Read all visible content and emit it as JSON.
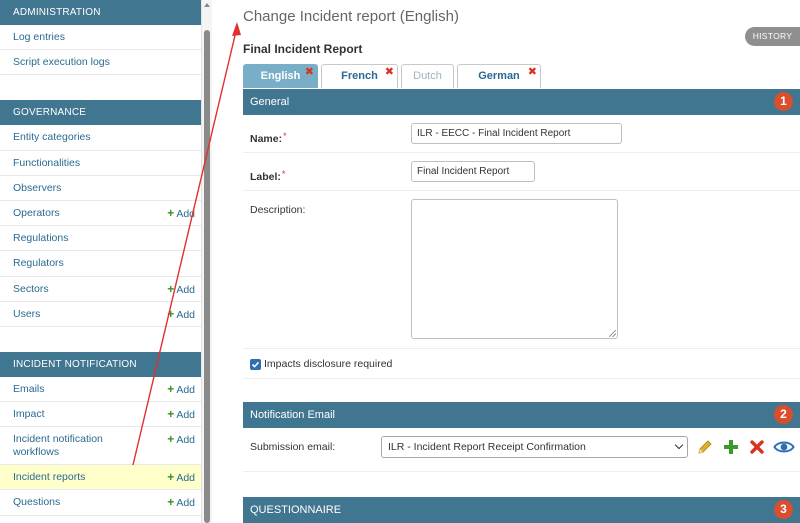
{
  "sidebar": {
    "administration": {
      "header": "ADMINISTRATION",
      "items": [
        {
          "label": "Log entries"
        },
        {
          "label": "Script execution logs"
        }
      ]
    },
    "governance": {
      "header": "GOVERNANCE",
      "items": [
        {
          "label": "Entity categories",
          "add": ""
        },
        {
          "label": "Functionalities",
          "add": ""
        },
        {
          "label": "Observers",
          "add": ""
        },
        {
          "label": "Operators",
          "add": "Add"
        },
        {
          "label": "Regulations",
          "add": ""
        },
        {
          "label": "Regulators",
          "add": ""
        },
        {
          "label": "Sectors",
          "add": "Add"
        },
        {
          "label": "Users",
          "add": "Add"
        }
      ]
    },
    "incident_notification": {
      "header": "INCIDENT NOTIFICATION",
      "items": [
        {
          "label": "Emails",
          "add": "Add"
        },
        {
          "label": "Impact",
          "add": "Add"
        },
        {
          "label_line1": "Incident notification",
          "label_line2": "workflows",
          "add": "Add"
        },
        {
          "label": "Incident reports",
          "add": "Add"
        },
        {
          "label": "Questions",
          "add": "Add"
        }
      ]
    }
  },
  "main": {
    "page_title": "Change Incident report (English)",
    "object_title": "Final Incident Report",
    "history_label": "HISTORY",
    "tabs": [
      {
        "label": "English",
        "state": "active"
      },
      {
        "label": "French",
        "state": "normal"
      },
      {
        "label": "Dutch",
        "state": "disabled"
      },
      {
        "label": "German",
        "state": "normal"
      }
    ],
    "general": {
      "header": "General",
      "badge": "1",
      "name_label": "Name:",
      "name_value": "ILR - EECC - Final Incident Report",
      "label_label": "Label:",
      "label_value": "Final Incident Report",
      "description_label": "Description:",
      "description_value": "",
      "checkbox_label": "Impacts disclosure required",
      "checkbox_checked": true
    },
    "notification_email": {
      "header": "Notification Email",
      "badge": "2",
      "submission_label": "Submission email:",
      "submission_value": "ILR - Incident Report Receipt Confirmation"
    },
    "questionnaire": {
      "header": "QUESTIONNAIRE",
      "badge": "3"
    }
  },
  "colors": {
    "header_blue": "#417690",
    "active_tab": "#79aec8",
    "link_blue": "#2a6a92",
    "add_green": "#3a8f2a",
    "badge_red": "#d94e2c",
    "arrow_red": "#e03030",
    "current_row": "#ffffcc"
  },
  "icons": {
    "edit": "pencil-icon",
    "add": "plus-icon",
    "delete": "x-icon",
    "view": "eye-icon"
  }
}
